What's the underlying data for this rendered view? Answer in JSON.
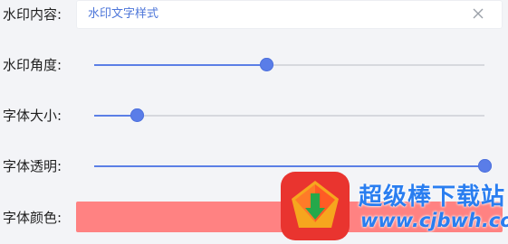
{
  "watermark_settings": {
    "content": {
      "label": "水印内容:",
      "value": "水印文字样式"
    },
    "angle": {
      "label": "水印角度:",
      "level": 0.44
    },
    "size": {
      "label": "字体大小:",
      "level": 0.11
    },
    "opacity": {
      "label": "字体透明:",
      "level": 1.0
    },
    "color": {
      "label": "字体颜色:",
      "value": "#ff8282"
    }
  },
  "overlay": {
    "title": "超级棒下载站",
    "url": "www.cjbwh.com"
  },
  "colors": {
    "accent": "#5b7fe6",
    "track": "#d6d8de",
    "background": "#f3f4f7"
  },
  "icons": {
    "clear": "close-icon",
    "logo": "download-app-logo"
  }
}
